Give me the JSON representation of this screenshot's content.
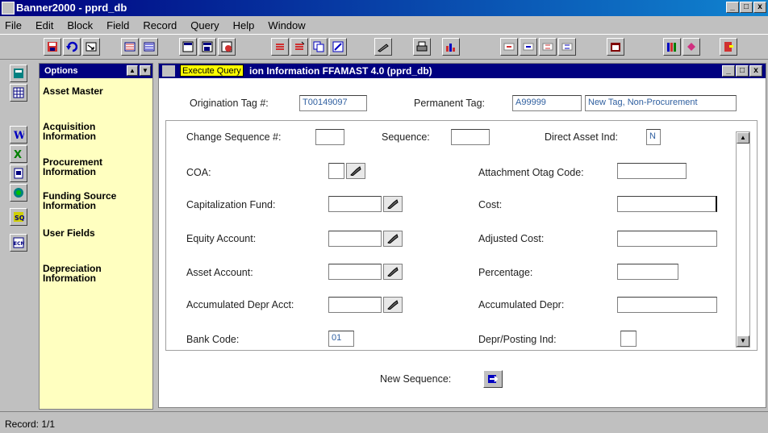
{
  "window": {
    "title": "Banner2000 - pprd_db",
    "minimize": "_",
    "maximize": "□",
    "close": "x"
  },
  "menu": [
    {
      "label": "File"
    },
    {
      "label": "Edit"
    },
    {
      "label": "Block"
    },
    {
      "label": "Field"
    },
    {
      "label": "Record"
    },
    {
      "label": "Query"
    },
    {
      "label": "Help"
    },
    {
      "label": "Window"
    }
  ],
  "options_panel": {
    "title": "Options",
    "items": [
      {
        "label": "Asset Master"
      },
      {
        "label": "Acquisition\nInformation"
      },
      {
        "label": "Procurement\nInformation"
      },
      {
        "label": "Funding Source\nInformation"
      },
      {
        "label": "User Fields"
      },
      {
        "label": "Depreciation\nInformation"
      }
    ]
  },
  "form": {
    "tooltip": "Execute Query",
    "title_rest": "ion Information  FFAMAST 4.0  (pprd_db)",
    "origination_tag_label": "Origination Tag #:",
    "origination_tag_value": "T00149097",
    "permanent_tag_label": "Permanent Tag:",
    "permanent_tag_value": "A99999",
    "permanent_tag_desc": "New Tag, Non-Procurement",
    "change_seq_label": "Change Sequence #:",
    "change_seq_value": "",
    "sequence_label": "Sequence:",
    "sequence_value": "",
    "direct_asset_label": "Direct Asset Ind:",
    "direct_asset_value": "N",
    "coa_label": "COA:",
    "coa_value": "",
    "attach_otag_label": "Attachment Otag Code:",
    "attach_otag_value": "",
    "cap_fund_label": "Capitalization Fund:",
    "cap_fund_value": "",
    "cost_label": "Cost:",
    "cost_value": "",
    "equity_label": "Equity Account:",
    "equity_value": "",
    "adj_cost_label": "Adjusted Cost:",
    "adj_cost_value": "",
    "asset_acct_label": "Asset Account:",
    "asset_acct_value": "",
    "percentage_label": "Percentage:",
    "percentage_value": "",
    "accum_acct_label": "Accumulated Depr Acct:",
    "accum_acct_value": "",
    "accum_depr_label": "Accumulated Depr:",
    "accum_depr_value": "",
    "bank_code_label": "Bank Code:",
    "bank_code_value": "01",
    "depr_posting_label": "Depr/Posting Ind:",
    "depr_posting_value": "",
    "new_seq_label": "New Sequence:"
  },
  "status": {
    "record": "Record: 1/1"
  },
  "colors": {
    "titlebar": "#000080",
    "options_bg": "#ffffc0",
    "chrome": "#c0c0c0",
    "field_text": "#3060a0"
  }
}
